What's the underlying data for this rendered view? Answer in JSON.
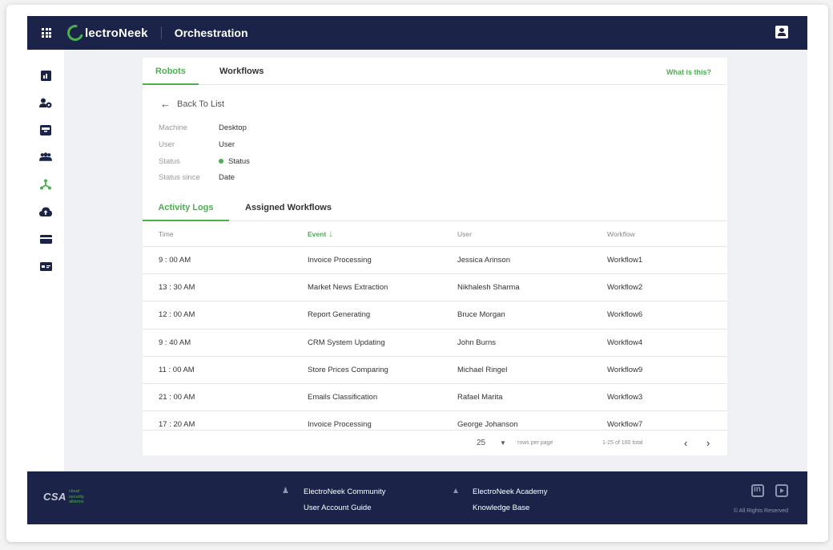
{
  "header": {
    "logo_text": "lectroNeek",
    "app_title": "Orchestration"
  },
  "sidebar": {
    "items": [
      {
        "icon": "dashboard-icon"
      },
      {
        "icon": "user-settings-icon"
      },
      {
        "icon": "inbox-icon"
      },
      {
        "icon": "users-icon"
      },
      {
        "icon": "robots-icon",
        "active": true
      },
      {
        "icon": "cloud-upload-icon"
      },
      {
        "icon": "card-icon"
      },
      {
        "icon": "license-icon"
      }
    ]
  },
  "top_tabs": [
    {
      "label": "Robots",
      "active": true
    },
    {
      "label": "Workflows",
      "active": false
    }
  ],
  "help_link": "What is this?",
  "back_label": "Back To List",
  "details": {
    "machine_label": "Machine",
    "machine_value": "Desktop",
    "user_label": "User",
    "user_value": "User",
    "status_label": "Status",
    "status_value": "Status",
    "since_label": "Status since",
    "since_value": "Date"
  },
  "sub_tabs": [
    {
      "label": "Activity Logs",
      "active": true
    },
    {
      "label": "Assigned Workflows",
      "active": false
    }
  ],
  "table": {
    "columns": [
      "Time",
      "Event",
      "User",
      "Workflow"
    ],
    "rows": [
      [
        "9 : 00 AM",
        "Invoice Processing",
        "Jessica Arinson",
        "Workflow1"
      ],
      [
        "13 : 30 AM",
        "Market News Extraction",
        "Nikhalesh Sharma",
        "Workflow2"
      ],
      [
        "12 : 00 AM",
        "Report Generating",
        "Bruce Morgan",
        "Workflow6"
      ],
      [
        "9 : 40 AM",
        "CRM System Updating",
        "John Burns",
        "Workflow4"
      ],
      [
        "11 : 00 AM",
        "Store Prices Comparing",
        "Michael Ringel",
        "Workflow9"
      ],
      [
        "21 : 00 AM",
        "Emails Classification",
        "Rafael Marita",
        "Workflow3"
      ],
      [
        "17 : 20 AM",
        "Invoice Processing",
        "George Johanson",
        "Workflow7"
      ]
    ]
  },
  "pager": {
    "rows_per_page": "25",
    "rows_per_page_label": "rows per page",
    "range": "1-25 of 100 total"
  },
  "footer": {
    "csa_big": "CSA",
    "csa_small_1": "cloud",
    "csa_small_2": "security",
    "csa_small_3": "alliance",
    "community": "ElectroNeek Community",
    "user_guide": "User Account Guide",
    "academy": "ElectroNeek Academy",
    "knowledge": "Knowledge Base",
    "copyright": "© All Rights Reserved"
  },
  "colors": {
    "navy": "#1b2448",
    "accent_green": "#4caf50"
  }
}
